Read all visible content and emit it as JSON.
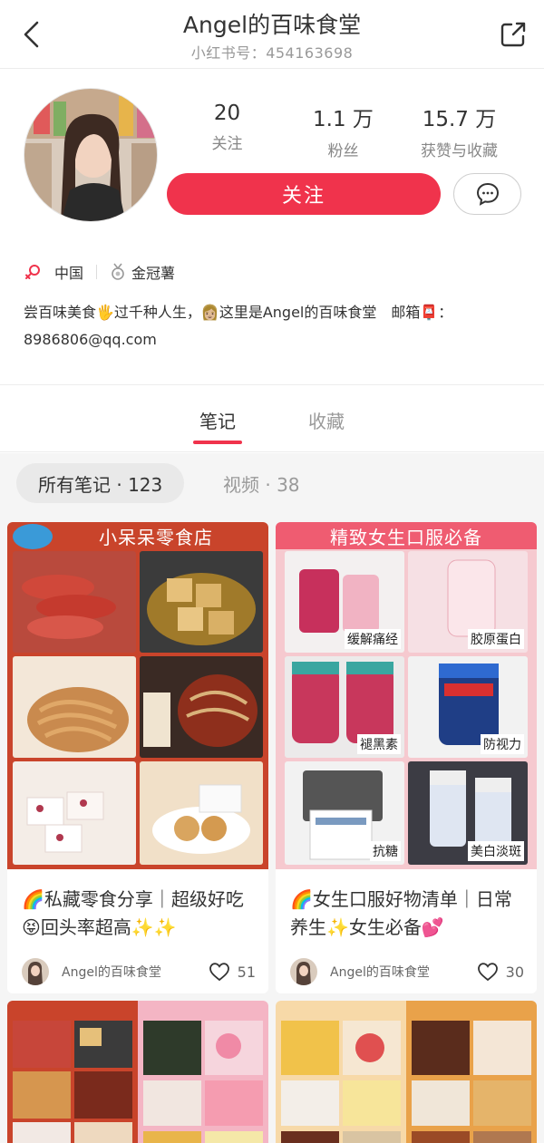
{
  "header": {
    "title": "Angel的百味食堂",
    "subtitle": "小红书号：454163698"
  },
  "profile": {
    "stats": [
      {
        "value": "20",
        "label": "关注"
      },
      {
        "value": "1.1 万",
        "label": "粉丝"
      },
      {
        "value": "15.7 万",
        "label": "获赞与收藏"
      }
    ],
    "follow_label": "关注",
    "location": "中国",
    "badge": "金冠薯",
    "bio_line1": "尝百味美食🖐过千种人生，👩🏼这里是Angel的百味食堂　邮箱📮：",
    "bio_line2": "8986806@qq.com"
  },
  "tabs": [
    {
      "label": "笔记"
    },
    {
      "label": "收藏"
    }
  ],
  "filters": {
    "active": "所有笔记 · 123",
    "inactive": "视频 · 38"
  },
  "colors": {
    "accent": "#f0334c",
    "card1_banner": "#c9442b",
    "card2_banner": "#ef5c71"
  },
  "cards": [
    {
      "banner": "小呆呆零食店",
      "title": "🌈私藏零食分享｜超级好吃😝回头率超高✨✨",
      "author": "Angel的百味食堂",
      "likes": "51"
    },
    {
      "banner": "精致女生口服必备",
      "labels": [
        "缓解痛经",
        "胶原蛋白",
        "褪黑素",
        "防视力",
        "抗糖",
        "美白淡斑"
      ],
      "title": "🌈女生口服好物清单｜日常养生✨女生必备💕",
      "author": "Angel的百味食堂",
      "likes": "30"
    }
  ]
}
